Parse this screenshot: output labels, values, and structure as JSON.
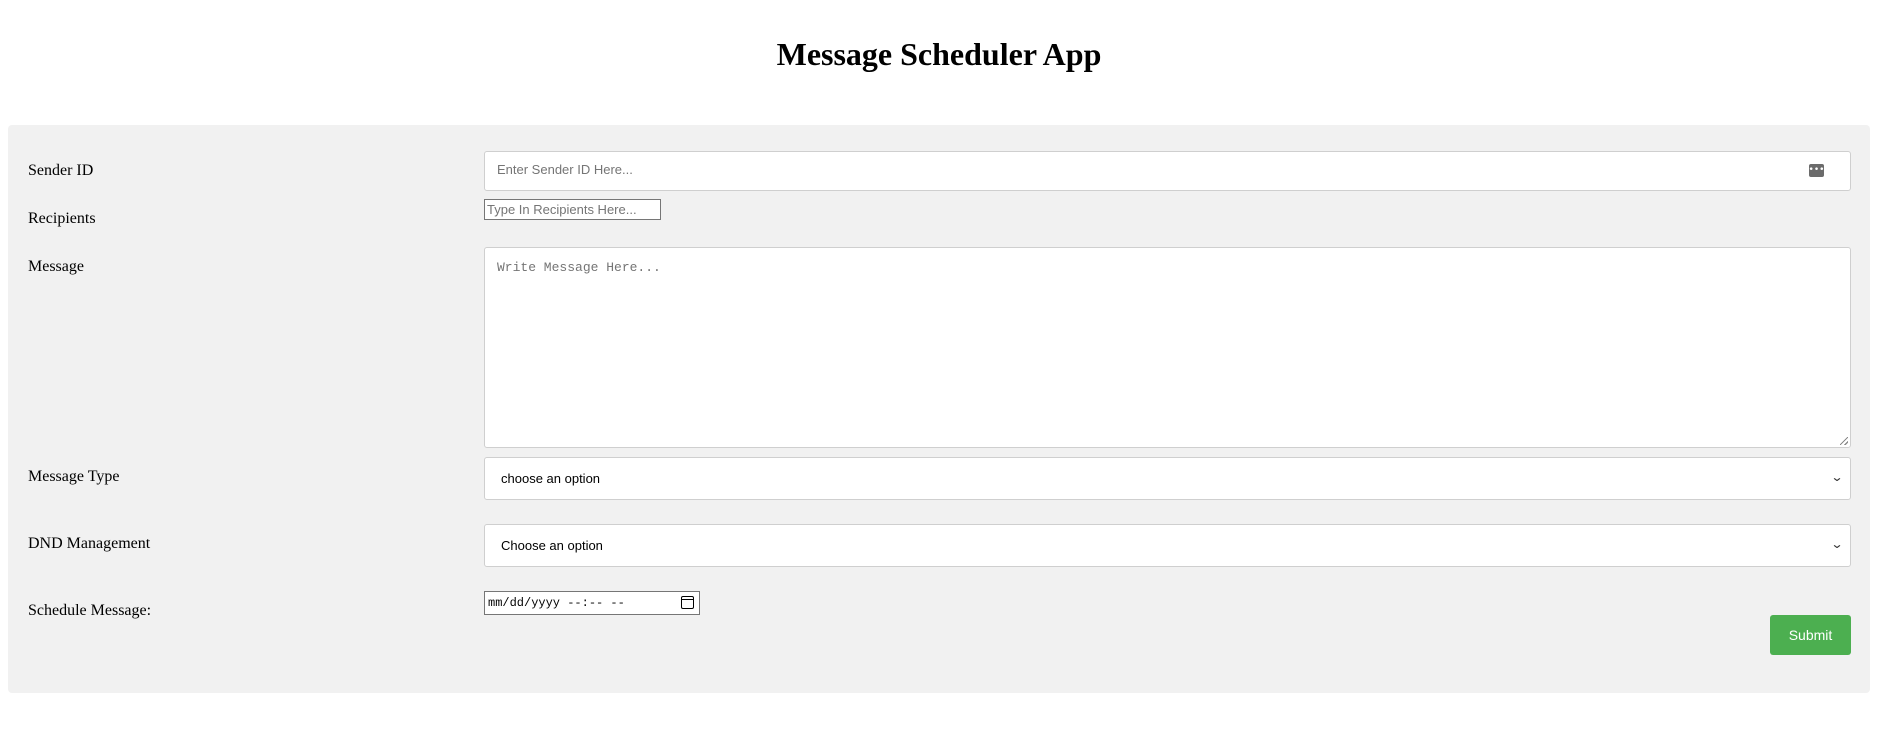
{
  "app": {
    "title": "Message Scheduler App"
  },
  "form": {
    "sender": {
      "label": "Sender ID",
      "placeholder": "Enter Sender ID Here...",
      "value": "",
      "icon": "password-manager-icon"
    },
    "recipients": {
      "label": "Recipients",
      "placeholder": "Type In Recipients Here...",
      "value": ""
    },
    "message": {
      "label": "Message",
      "placeholder": "Write Message Here...",
      "value": ""
    },
    "message_type": {
      "label": "Message Type",
      "selected": "choose an option"
    },
    "dnd": {
      "label": "DND Management",
      "selected": "Choose an option"
    },
    "schedule": {
      "label": "Schedule Message:",
      "placeholder": "mm/dd/yyyy --:-- --",
      "icon": "calendar-icon"
    },
    "submit_label": "Submit"
  },
  "colors": {
    "panel_bg": "#f1f1f1",
    "submit_bg": "#4caf50",
    "submit_text": "#ffffff"
  }
}
